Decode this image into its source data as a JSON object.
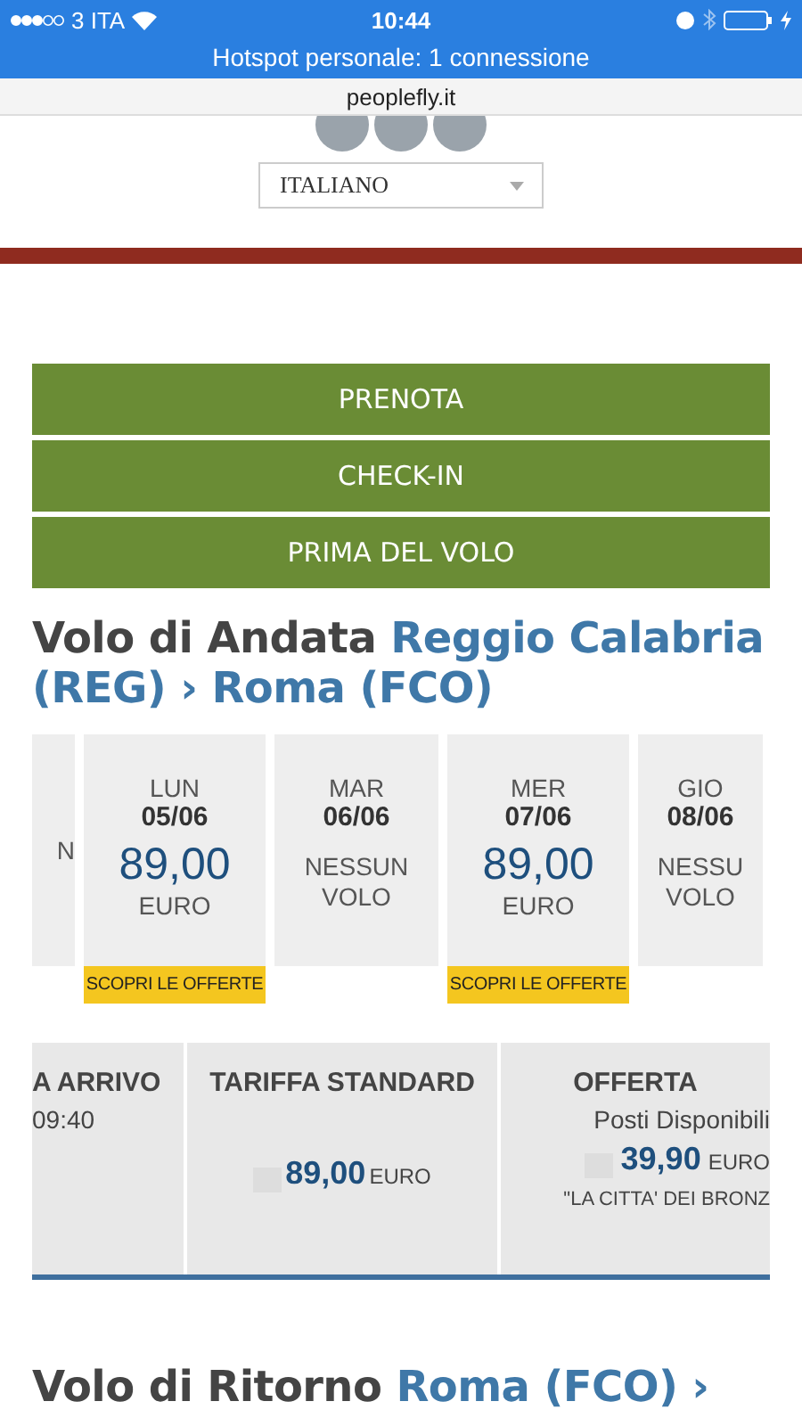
{
  "status_bar": {
    "carrier": "3 ITA",
    "time": "10:44",
    "hotspot": "Hotspot personale: 1 connessione"
  },
  "address_bar": {
    "url": "peoplefly.it"
  },
  "language_select": {
    "value": "ITALIANO"
  },
  "nav_buttons": [
    "PRENOTA",
    "CHECK-IN",
    "PRIMA DEL VOLO"
  ],
  "outbound_heading": {
    "prefix": "Volo di Andata",
    "route": "Reggio Calabria (REG) › Roma (FCO)"
  },
  "days": [
    {
      "kind": "partial",
      "lines": [
        "N"
      ]
    },
    {
      "kind": "price",
      "day": "LUN",
      "date": "05/06",
      "price": "89,00",
      "currency": "EURO",
      "offer": "SCOPRI LE OFFERTE"
    },
    {
      "kind": "none",
      "day": "MAR",
      "date": "06/06",
      "lines": [
        "NESSUN",
        "VOLO"
      ]
    },
    {
      "kind": "price",
      "day": "MER",
      "date": "07/06",
      "price": "89,00",
      "currency": "EURO",
      "offer": "SCOPRI LE OFFERTE"
    },
    {
      "kind": "none",
      "day": "GIO",
      "date": "08/06",
      "lines": [
        "NESSU",
        "VOLO"
      ]
    }
  ],
  "fares": {
    "arrival": {
      "header": "A ARRIVO",
      "time": "09:40"
    },
    "standard": {
      "header": "TARIFFA STANDARD",
      "price": "89,00",
      "currency": "EURO"
    },
    "offer": {
      "header": "OFFERTA",
      "note": "Posti Disponibili",
      "price": "39,90",
      "currency": "EURO",
      "name": "\"LA CITTA' DEI BRONZ"
    }
  },
  "return_heading": {
    "prefix": "Volo di Ritorno",
    "route": "Roma (FCO) ›"
  }
}
